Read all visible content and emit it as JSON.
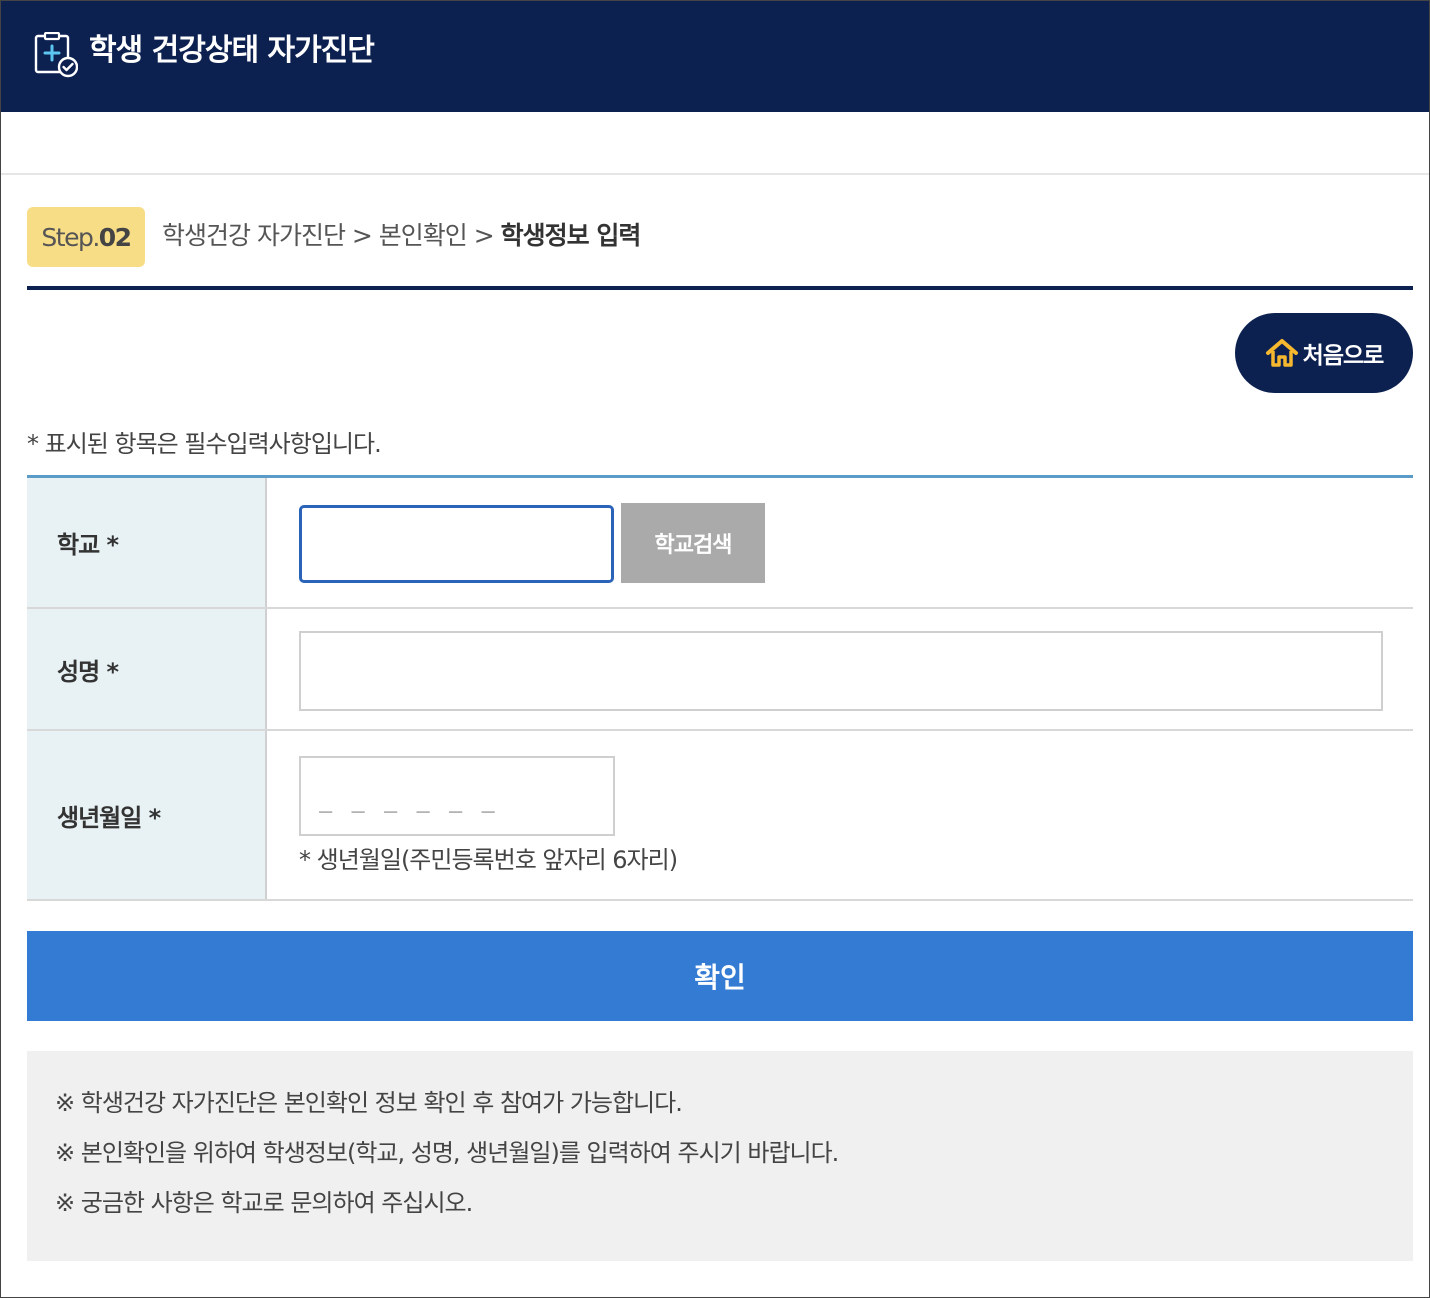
{
  "header": {
    "title": "학생 건강상태 자가진단",
    "icon": "clipboard-medical-icon",
    "bg_color": "#0c2150"
  },
  "step": {
    "label": "Step.",
    "number": "02",
    "badge_color": "#f8dd87"
  },
  "breadcrumb": {
    "path": "학생건강 자가진단 > 본인확인 > ",
    "current": "학생정보 입력"
  },
  "home_button": {
    "icon": "home-icon",
    "label": "처음으로"
  },
  "required_note": "* 표시된 항목은 필수입력사항입니다.",
  "form": {
    "school": {
      "label": "학교 *",
      "value": "",
      "search_button": "학교검색"
    },
    "name": {
      "label": "성명 *",
      "value": ""
    },
    "birth": {
      "label": "생년월일 *",
      "mask": "______",
      "help": "* 생년월일(주민등록번호 앞자리 6자리)"
    }
  },
  "confirm_button": {
    "label": "확인",
    "color": "#337bd3"
  },
  "notices": [
    "※ 학생건강 자가진단은 본인확인 정보 확인 후 참여가 가능합니다.",
    "※ 본인확인을 위하여 학생정보(학교, 성명, 생년월일)를 입력하여 주시기 바랍니다.",
    "※ 궁금한 사항은 학교로 문의하여 주십시오."
  ]
}
